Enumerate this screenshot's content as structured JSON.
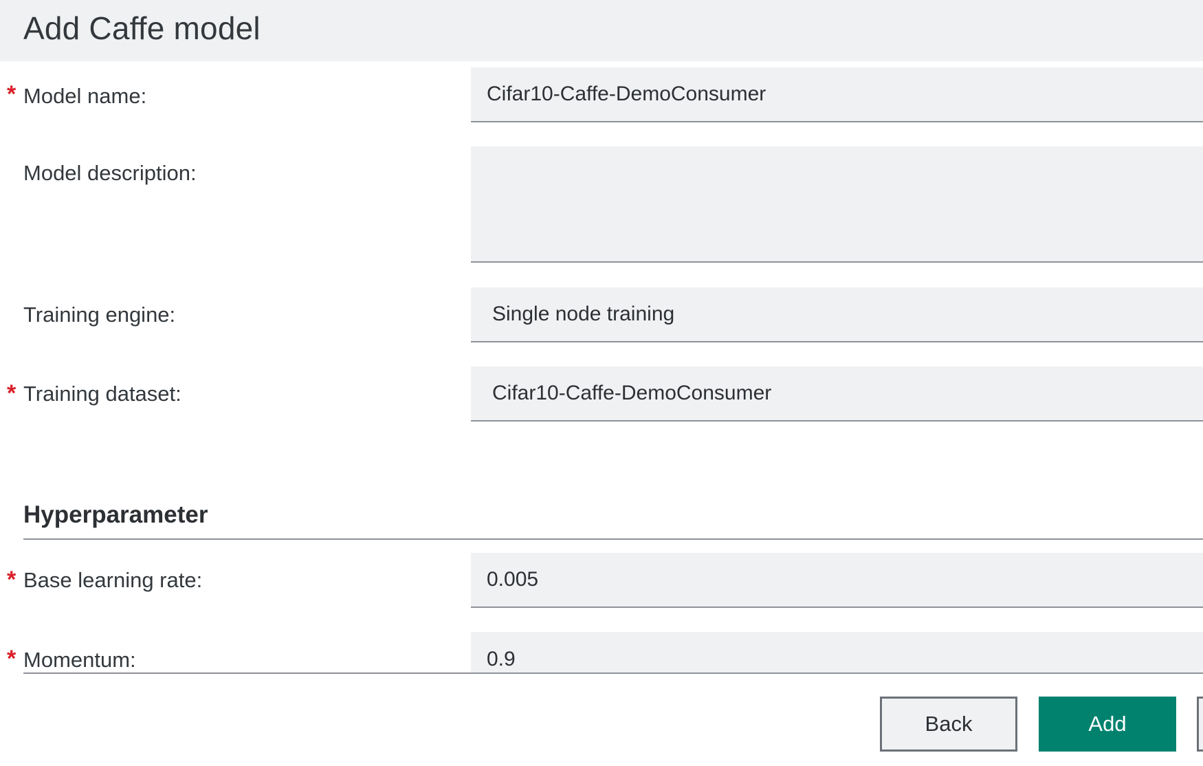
{
  "header": {
    "title": "Add Caffe model"
  },
  "form": {
    "model_name": {
      "required_mark": "*",
      "label": "Model name:",
      "value": "Cifar10-Caffe-DemoConsumer"
    },
    "model_description": {
      "label": "Model description:",
      "value": ""
    },
    "training_engine": {
      "label": "Training engine:",
      "value": "Single node training"
    },
    "training_dataset": {
      "required_mark": "*",
      "label": "Training dataset:",
      "value": "Cifar10-Caffe-DemoConsumer"
    }
  },
  "hyperparameter": {
    "title": "Hyperparameter",
    "base_learning_rate": {
      "required_mark": "*",
      "label": "Base learning rate:",
      "value": "0.005"
    },
    "momentum": {
      "required_mark": "*",
      "label": "Momentum:",
      "value": "0.9"
    }
  },
  "buttons": {
    "back": "Back",
    "add": "Add"
  },
  "colors": {
    "accent": "#00826f",
    "required": "#da1e28",
    "field_bg": "#f0f1f3",
    "header_bg": "#f0f1f3"
  }
}
